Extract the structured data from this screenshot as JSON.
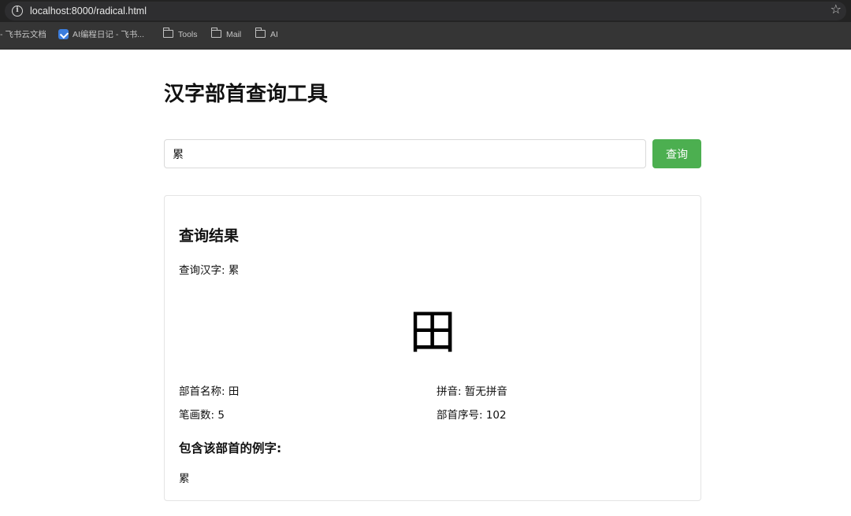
{
  "browser": {
    "url": "localhost:8000/radical.html",
    "bookmarks": [
      {
        "label": "- 飞书云文档",
        "type": "page"
      },
      {
        "label": "AI编程日记 - 飞书...",
        "type": "favicon"
      },
      {
        "label": "Tools",
        "type": "folder"
      },
      {
        "label": "Mail",
        "type": "folder"
      },
      {
        "label": "AI",
        "type": "folder"
      }
    ],
    "icons": {
      "info": "info-icon",
      "star": "star-icon",
      "folder": "folder-icon"
    }
  },
  "page": {
    "title": "汉字部首查询工具"
  },
  "search": {
    "value": "累",
    "button_label": "查询"
  },
  "result": {
    "title": "查询结果",
    "query_label": "查询汉字: 累",
    "radical_char": "田",
    "radical_name": "部首名称: 田",
    "pinyin": "拼音: 暂无拼音",
    "strokes": "笔画数: 5",
    "radical_index": "部首序号: 102",
    "examples_heading": "包含该部首的例字:",
    "examples": "累"
  },
  "colors": {
    "accent_button": "#4caf50",
    "browser_bar": "#232323",
    "bookmarks_bar": "#353535"
  }
}
